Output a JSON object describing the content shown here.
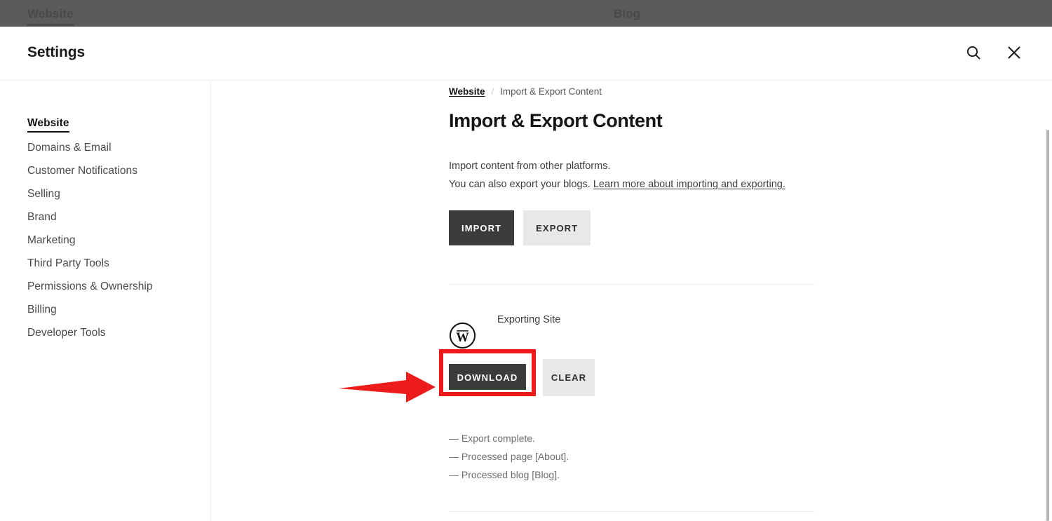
{
  "backdrop": {
    "tabs": [
      {
        "label": "Website",
        "active": true
      },
      {
        "label": "Blog",
        "active": false
      }
    ]
  },
  "header": {
    "title": "Settings",
    "search_icon": "search-icon",
    "close_icon": "close-icon"
  },
  "sidebar": {
    "items": [
      {
        "label": "Website",
        "active": true
      },
      {
        "label": "Domains & Email",
        "active": false
      },
      {
        "label": "Customer Notifications",
        "active": false
      },
      {
        "label": "Selling",
        "active": false
      },
      {
        "label": "Brand",
        "active": false
      },
      {
        "label": "Marketing",
        "active": false
      },
      {
        "label": "Third Party Tools",
        "active": false
      },
      {
        "label": "Permissions & Ownership",
        "active": false
      },
      {
        "label": "Billing",
        "active": false
      },
      {
        "label": "Developer Tools",
        "active": false
      }
    ]
  },
  "main": {
    "breadcrumb": {
      "parent": "Website",
      "separator": "/",
      "current": "Import & Export Content"
    },
    "title": "Import & Export Content",
    "description": {
      "line1": "Import content from other platforms.",
      "line2_prefix": "You can also export your blogs. ",
      "link_text": "Learn more about importing and exporting."
    },
    "primary_actions": {
      "import_label": "IMPORT",
      "export_label": "EXPORT"
    },
    "export_section": {
      "icon": "wordpress-icon",
      "site_label": "Exporting Site",
      "download_label": "DOWNLOAD",
      "clear_label": "CLEAR",
      "status_lines": [
        "— Export complete.",
        "— Processed page [About].",
        "— Processed blog [Blog]."
      ]
    }
  },
  "annotation": {
    "highlight_color": "#ee1b1b",
    "arrow": "right-arrow-annotation",
    "target": "DOWNLOAD"
  },
  "colors": {
    "button_dark": "#3b3b3b",
    "button_light": "#e8e8e8",
    "text_primary": "#141414",
    "text_muted": "#6f6f6f",
    "divider": "#ececec",
    "backdrop": "#5e5e5e"
  }
}
